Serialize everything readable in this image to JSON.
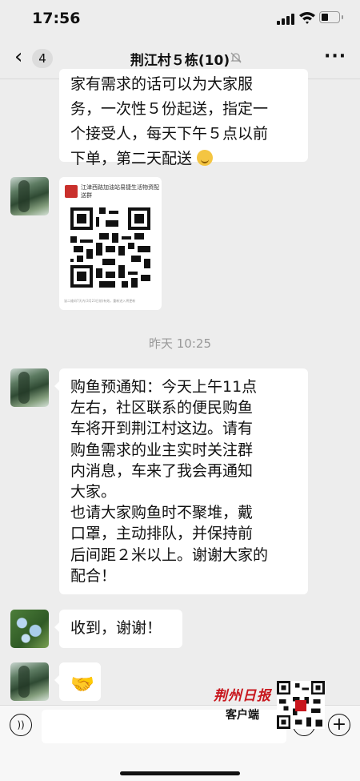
{
  "status_bar": {
    "time": "17:56"
  },
  "header": {
    "back_count": "4",
    "title": "荆江村５栋(10)"
  },
  "messages": {
    "m1_lines": [
      "家有需求的话可以为大家服",
      "务，一次性５份起送，指定一",
      "个接受人，每天下午５点以前",
      "下单，第二天配送"
    ],
    "card": {
      "title": "江津西路加油站易捷生活物资配送群",
      "footer": "该二维码7天内(3月23日前)有效，重新进入将更新"
    },
    "timestamp": "昨天 10:25",
    "m3_lines": [
      "购鱼预通知：今天上午11点",
      "左右，社区联系的便民购鱼",
      "车将开到荆江村这边。请有",
      "购鱼需求的业主实时关注群",
      "内消息，车来了我会再通知",
      "大家。",
      "也请大家购鱼时不聚堆，戴",
      "口罩，主动排队，并保持前",
      "后间距２米以上。谢谢大家的",
      "配合！"
    ],
    "m4": "收到，谢谢！",
    "m5_emoji": "🤝"
  },
  "watermark": {
    "name": "荆州日报",
    "sub": "客户端"
  },
  "icons": {
    "back": "chevron-left-icon",
    "mute": "bell-slash-icon",
    "more": "ellipsis-icon",
    "voice": "voice-icon",
    "emoji": "emoji-icon",
    "plus": "plus-icon"
  }
}
